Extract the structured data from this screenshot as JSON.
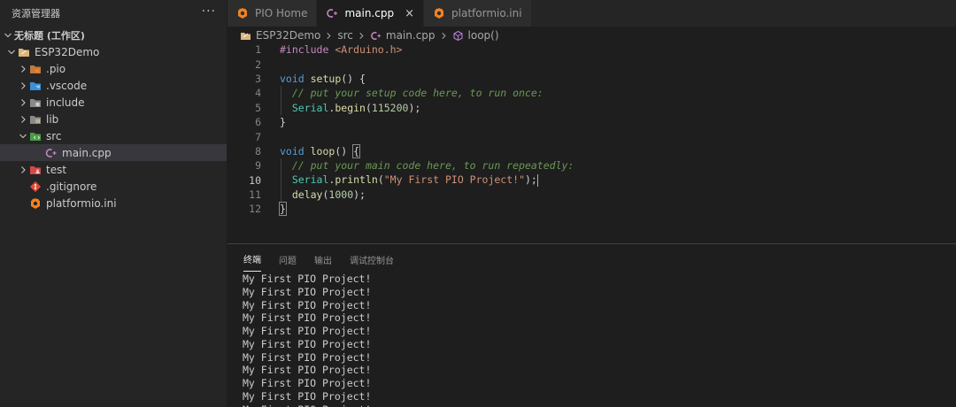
{
  "sidebar": {
    "title": "资源管理器",
    "more": "···",
    "workspace": "无标题 (工作区)",
    "items": [
      {
        "label": "ESP32Demo",
        "chev": "down",
        "icon": "folder-project-icon",
        "depth": 1
      },
      {
        "label": ".pio",
        "chev": "right",
        "icon": "pio-folder-icon",
        "depth": 2
      },
      {
        "label": ".vscode",
        "chev": "right",
        "icon": "vscode-folder-icon",
        "depth": 2
      },
      {
        "label": "include",
        "chev": "right",
        "icon": "include-folder-icon",
        "depth": 2
      },
      {
        "label": "lib",
        "chev": "right",
        "icon": "lib-folder-icon",
        "depth": 2
      },
      {
        "label": "src",
        "chev": "down",
        "icon": "src-folder-icon",
        "depth": 2
      },
      {
        "label": "main.cpp",
        "chev": "none",
        "icon": "cpp-file-icon",
        "depth": 3,
        "selected": true
      },
      {
        "label": "test",
        "chev": "right",
        "icon": "test-folder-icon",
        "depth": 2
      },
      {
        "label": ".gitignore",
        "chev": "none",
        "icon": "git-file-icon",
        "depth": 2
      },
      {
        "label": "platformio.ini",
        "chev": "none",
        "icon": "platformio-file-icon",
        "depth": 2
      }
    ]
  },
  "tabs": [
    {
      "label": "PIO Home",
      "icon": "platformio-icon",
      "active": false
    },
    {
      "label": "main.cpp",
      "icon": "cpp-file-icon",
      "active": true,
      "close": "×"
    },
    {
      "label": "platformio.ini",
      "icon": "platformio-file-icon",
      "active": false
    }
  ],
  "breadcrumb": {
    "project": "ESP32Demo",
    "folder": "src",
    "file": "main.cpp",
    "symbol": "loop()"
  },
  "editor": {
    "active_line": 10,
    "lines": [
      {
        "n": "1",
        "tokens": [
          [
            "kw",
            "#include "
          ],
          [
            "str",
            "<Arduino.h>"
          ]
        ]
      },
      {
        "n": "2",
        "tokens": []
      },
      {
        "n": "3",
        "tokens": [
          [
            "type",
            "void "
          ],
          [
            "fn",
            "setup"
          ],
          [
            "punct",
            "() {"
          ]
        ]
      },
      {
        "n": "4",
        "tokens": [
          [
            "punct",
            "  "
          ],
          [
            "cmt",
            "// put your setup code here, to run once:"
          ]
        ]
      },
      {
        "n": "5",
        "tokens": [
          [
            "punct",
            "  "
          ],
          [
            "obj",
            "Serial"
          ],
          [
            "punct",
            "."
          ],
          [
            "fn",
            "begin"
          ],
          [
            "punct",
            "("
          ],
          [
            "num",
            "115200"
          ],
          [
            "punct",
            ");"
          ]
        ]
      },
      {
        "n": "6",
        "tokens": [
          [
            "punct",
            "}"
          ]
        ]
      },
      {
        "n": "7",
        "tokens": []
      },
      {
        "n": "8",
        "tokens": [
          [
            "type",
            "void "
          ],
          [
            "fn",
            "loop"
          ],
          [
            "punct",
            "() "
          ],
          [
            "brace",
            "{"
          ]
        ]
      },
      {
        "n": "9",
        "tokens": [
          [
            "punct",
            "  "
          ],
          [
            "cmt",
            "// put your main code here, to run repeatedly:"
          ]
        ]
      },
      {
        "n": "10",
        "tokens": [
          [
            "punct",
            "  "
          ],
          [
            "obj",
            "Serial"
          ],
          [
            "punct",
            "."
          ],
          [
            "fn",
            "println"
          ],
          [
            "punct",
            "("
          ],
          [
            "str",
            "\"My First PIO Project!\""
          ],
          [
            "punct",
            ");"
          ]
        ]
      },
      {
        "n": "11",
        "tokens": [
          [
            "punct",
            "  "
          ],
          [
            "fn",
            "delay"
          ],
          [
            "punct",
            "("
          ],
          [
            "num",
            "1000"
          ],
          [
            "punct",
            ");"
          ]
        ]
      },
      {
        "n": "12",
        "tokens": [
          [
            "brace",
            "}"
          ]
        ]
      }
    ]
  },
  "panel": {
    "tabs": [
      {
        "label": "终端",
        "active": true
      },
      {
        "label": "问题",
        "active": false
      },
      {
        "label": "输出",
        "active": false
      },
      {
        "label": "调试控制台",
        "active": false
      }
    ],
    "terminal_lines": [
      "My First PIO Project!",
      "My First PIO Project!",
      "My First PIO Project!",
      "My First PIO Project!",
      "My First PIO Project!",
      "My First PIO Project!",
      "My First PIO Project!",
      "My First PIO Project!",
      "My First PIO Project!",
      "My First PIO Project!",
      "My First PIO Project!"
    ]
  },
  "colors": {
    "background": "#1e1e1e",
    "sidebar": "#252526",
    "selected_row": "#37373d",
    "keyword": "#c586c0",
    "type": "#569cd6",
    "function": "#dcdcaa",
    "string": "#ce9178",
    "number": "#b5cea8",
    "comment": "#6a9955",
    "object": "#4ec9b0",
    "platformio_orange": "#f5821f"
  }
}
